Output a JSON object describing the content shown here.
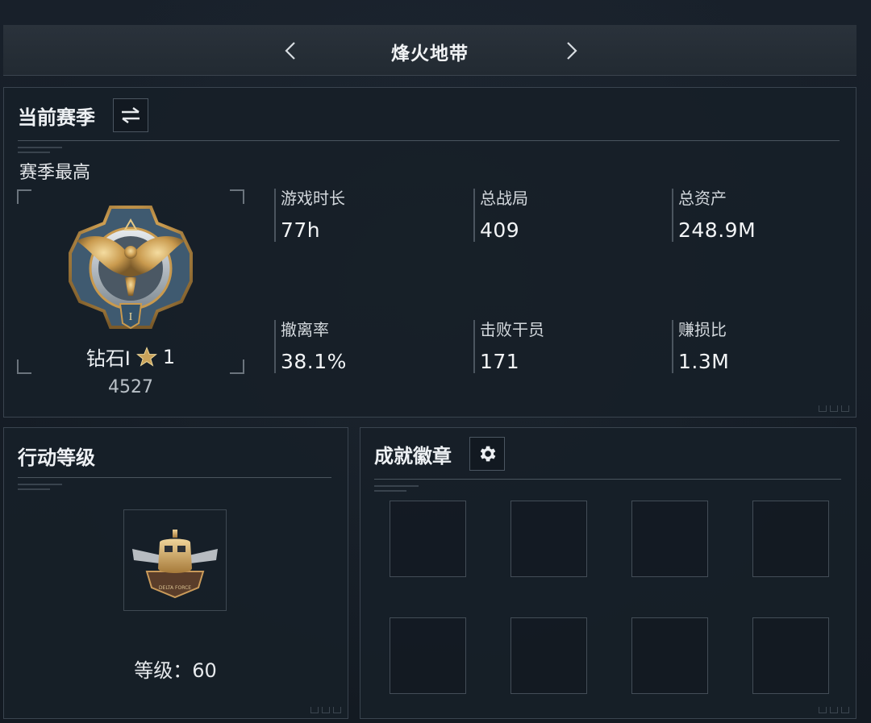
{
  "header": {
    "title": "烽火地带",
    "prev_icon": "chevron-left-icon",
    "next_icon": "chevron-right-icon"
  },
  "current_season": {
    "heading": "当前赛季",
    "switch_icon": "swap-arrows-icon",
    "best_label": "赛季最高",
    "rank": {
      "name": "钻石I",
      "star_icon": "star-icon",
      "stars": "1",
      "score": "4527"
    },
    "stats": [
      {
        "label": "游戏时长",
        "value": "77h"
      },
      {
        "label": "总战局",
        "value": "409"
      },
      {
        "label": "总资产",
        "value": "248.9M"
      },
      {
        "label": "撤离率",
        "value": "38.1%"
      },
      {
        "label": "击败干员",
        "value": "171"
      },
      {
        "label": "赚损比",
        "value": "1.3M"
      }
    ]
  },
  "action_level": {
    "heading": "行动等级",
    "level_label": "等级：60"
  },
  "achievements": {
    "heading": "成就徽章",
    "settings_icon": "gear-icon",
    "slot_count": 8
  },
  "colors": {
    "background": "#141b23",
    "panel": "#171f28",
    "border": "#3a444f",
    "gold": "#c9a25a"
  }
}
